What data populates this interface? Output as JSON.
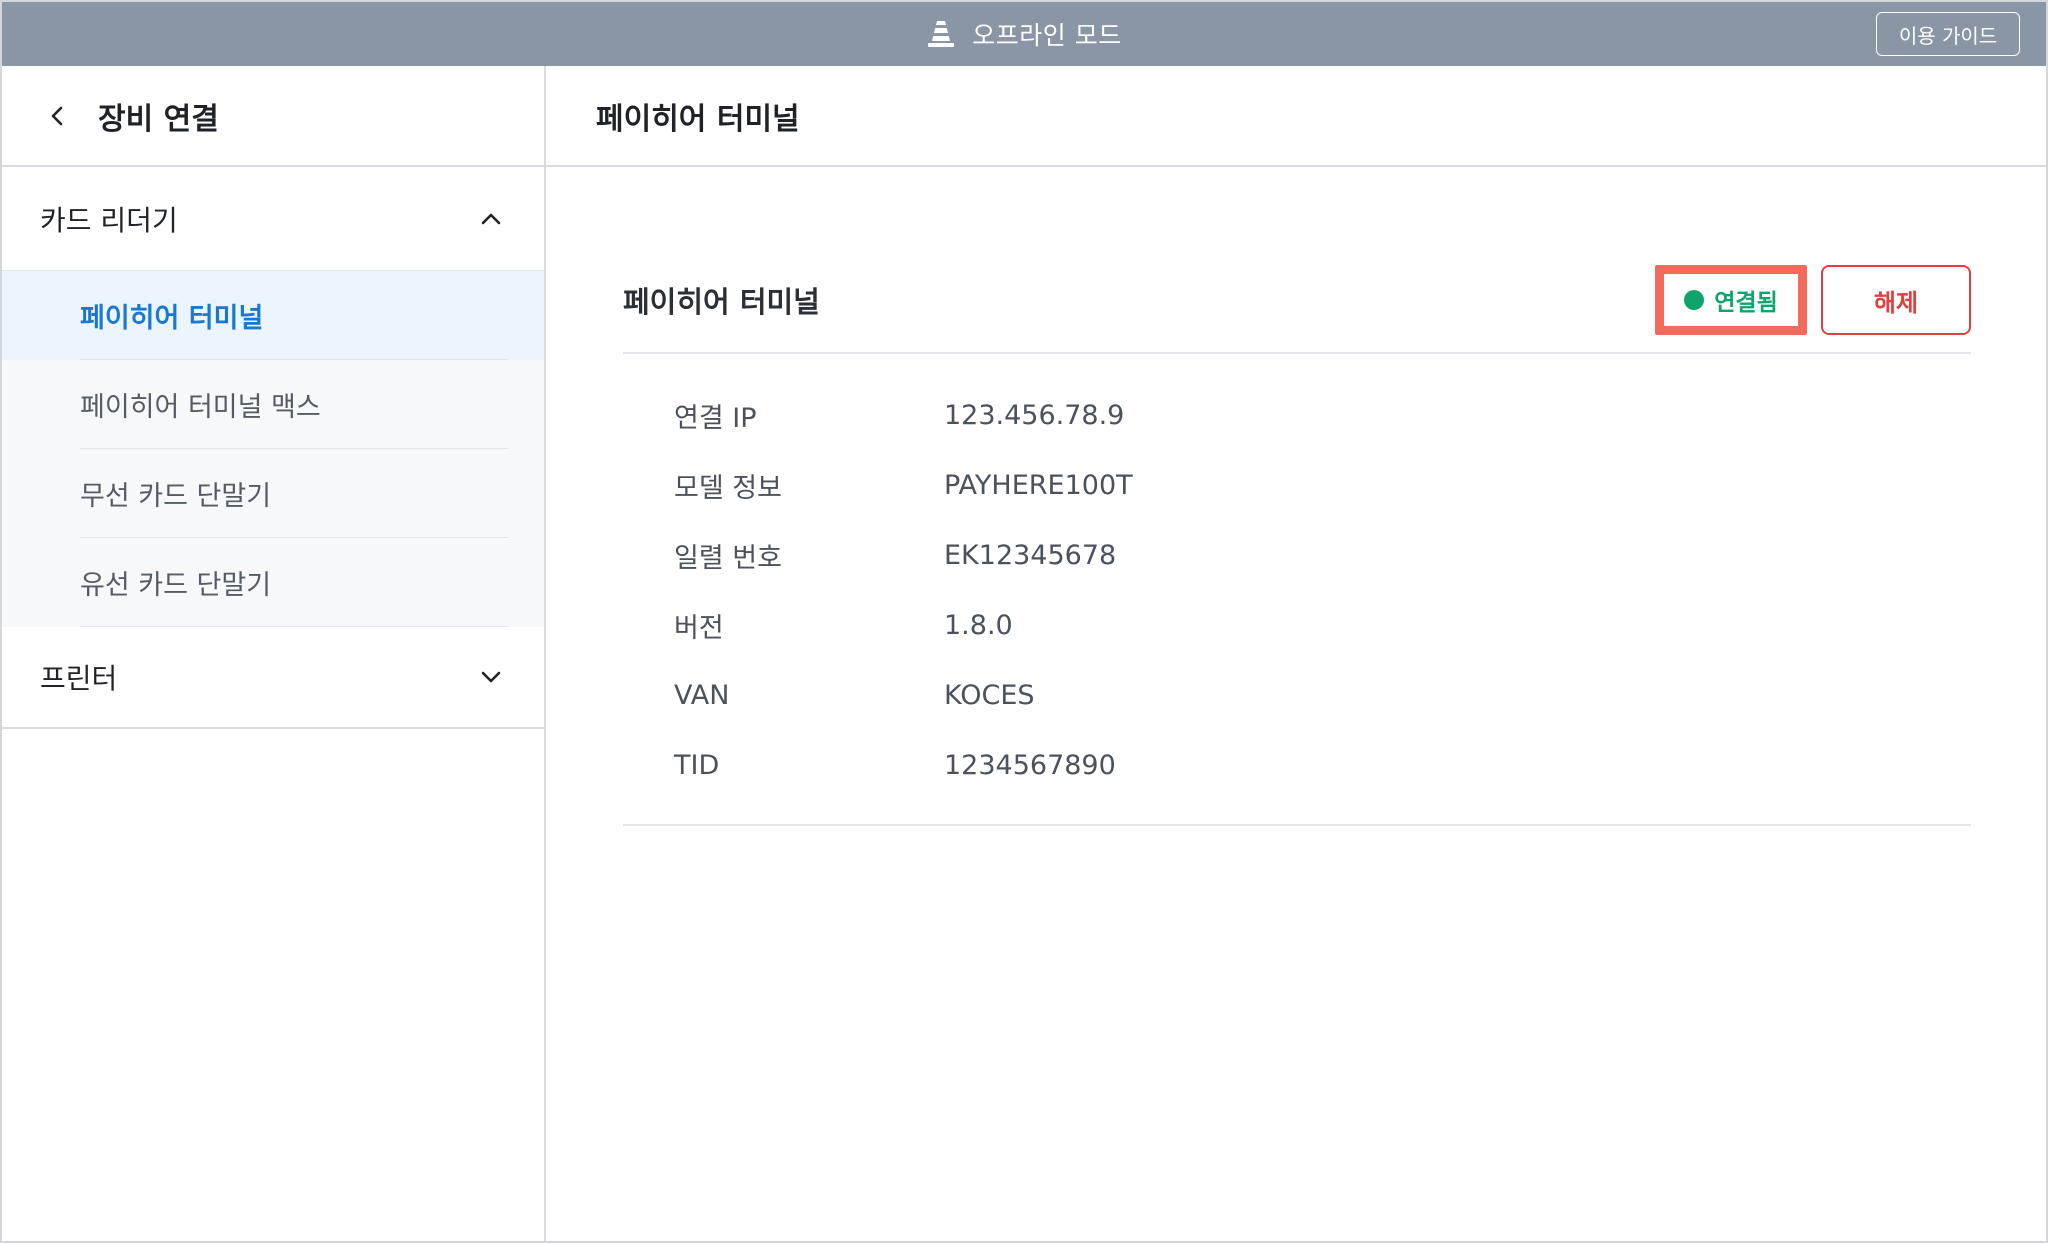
{
  "topbar": {
    "mode_title": "오프라인 모드",
    "mode_icon": "traffic-cone-icon",
    "guide_label": "이용 가이드",
    "background_color": "#8a96a6"
  },
  "sidebar": {
    "title": "장비 연결",
    "back_icon": "chevron-left-icon",
    "groups": [
      {
        "label": "카드 리더기",
        "expanded": true,
        "items": [
          {
            "label": "페이히어 터미널",
            "active": true
          },
          {
            "label": "페이히어 터미널 맥스",
            "active": false
          },
          {
            "label": "무선 카드 단말기",
            "active": false
          },
          {
            "label": "유선 카드 단말기",
            "active": false
          }
        ]
      },
      {
        "label": "프린터",
        "expanded": false,
        "items": []
      }
    ]
  },
  "main": {
    "title": "페이히어 터미널",
    "device": {
      "name": "페이히어 터미널",
      "status_label": "연결됨",
      "status_color": "#11a36c",
      "highlight_color": "#f26a5b",
      "disconnect_label": "해제",
      "disconnect_color": "#e2403f",
      "info": [
        {
          "label": "연결 IP",
          "value": "123.456.78.9"
        },
        {
          "label": "모델 정보",
          "value": "PAYHERE100T"
        },
        {
          "label": "일렬 번호",
          "value": "EK12345678"
        },
        {
          "label": "버전",
          "value": "1.8.0"
        },
        {
          "label": "VAN",
          "value": "KOCES"
        },
        {
          "label": "TID",
          "value": "1234567890"
        }
      ]
    }
  },
  "accent_color": "#1a78d2"
}
